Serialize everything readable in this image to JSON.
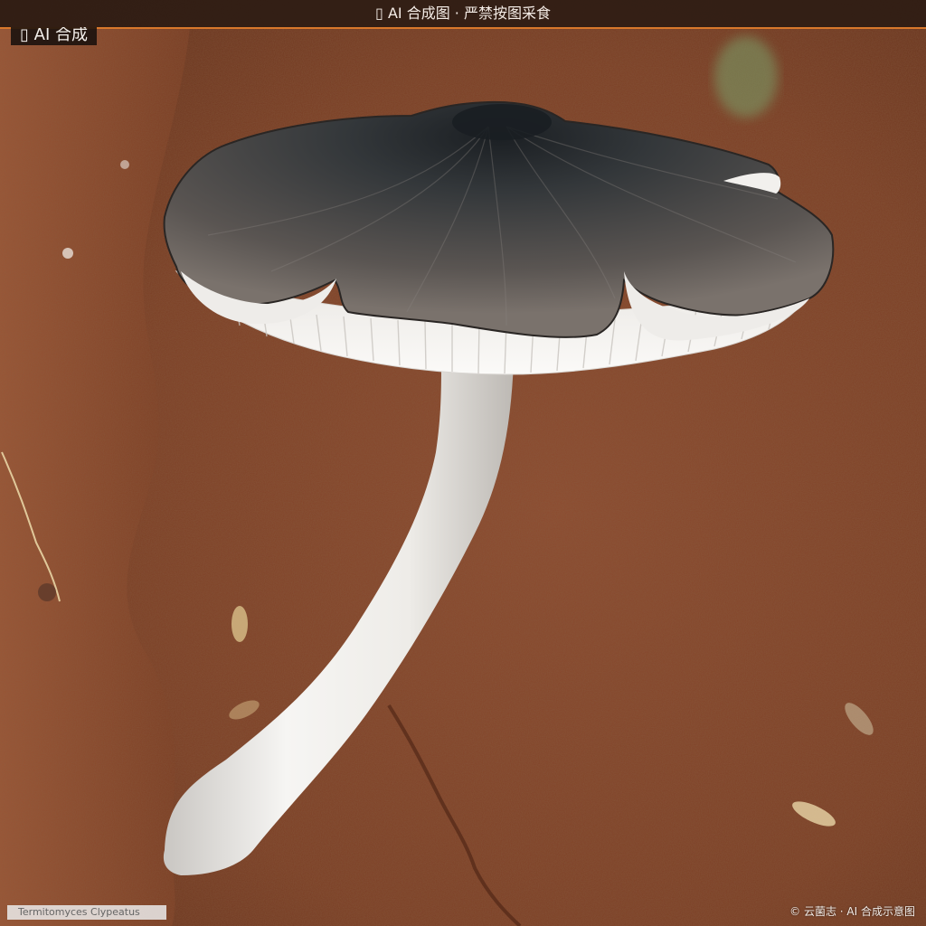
{
  "header": {
    "title": "▯ AI 合成图 · 严禁按图采食"
  },
  "badge": {
    "label": "▯ AI 合成"
  },
  "caption": {
    "species": "Termitomyces Clypeatus"
  },
  "credit": {
    "text": "© 云菌志 · AI 合成示意图"
  },
  "colors": {
    "soil": "#8a4a2e",
    "soil_dark": "#6b3520",
    "cap": "#4a4745",
    "cap_center": "#1e2327",
    "gills": "#f3f1ee",
    "stem": "#eceae6",
    "accent": "#d9782b"
  }
}
